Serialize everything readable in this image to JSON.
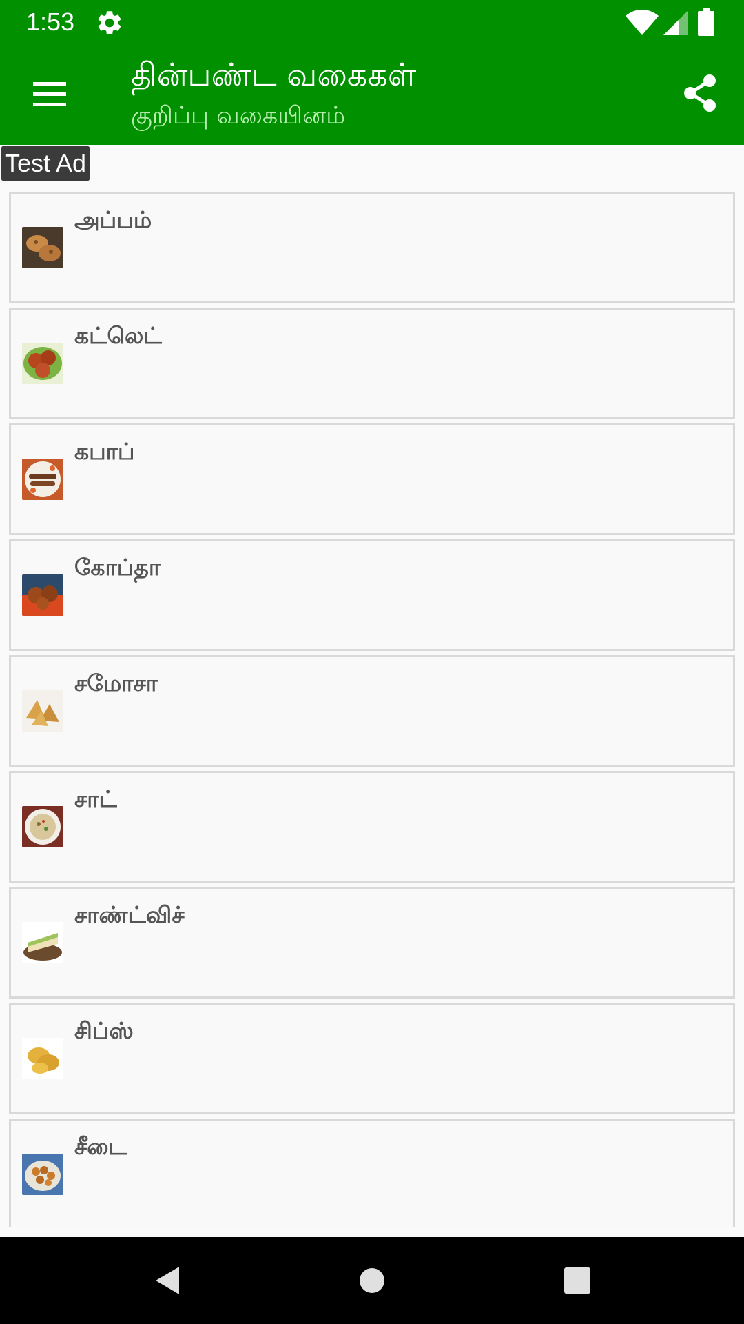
{
  "status_bar": {
    "time": "1:53"
  },
  "app_bar": {
    "title": "தின்பண்ட வகைகள்",
    "subtitle": "குறிப்பு வகையினம்",
    "background_color": "#009000"
  },
  "ad": {
    "label": "Test Ad"
  },
  "recipes": [
    {
      "name": "அப்பம்"
    },
    {
      "name": "கட்லெட்"
    },
    {
      "name": "கபாப்"
    },
    {
      "name": "கோப்தா"
    },
    {
      "name": "சமோசா"
    },
    {
      "name": "சாட்"
    },
    {
      "name": "சாண்ட்விச்"
    },
    {
      "name": "சிப்ஸ்"
    },
    {
      "name": "சீடை"
    }
  ],
  "icons": {
    "status": [
      "gear-icon",
      "wifi-icon",
      "signal-icon",
      "battery-icon"
    ],
    "app_bar": [
      "menu-icon",
      "share-icon"
    ],
    "nav": [
      "back-icon",
      "home-icon",
      "recents-icon"
    ]
  }
}
